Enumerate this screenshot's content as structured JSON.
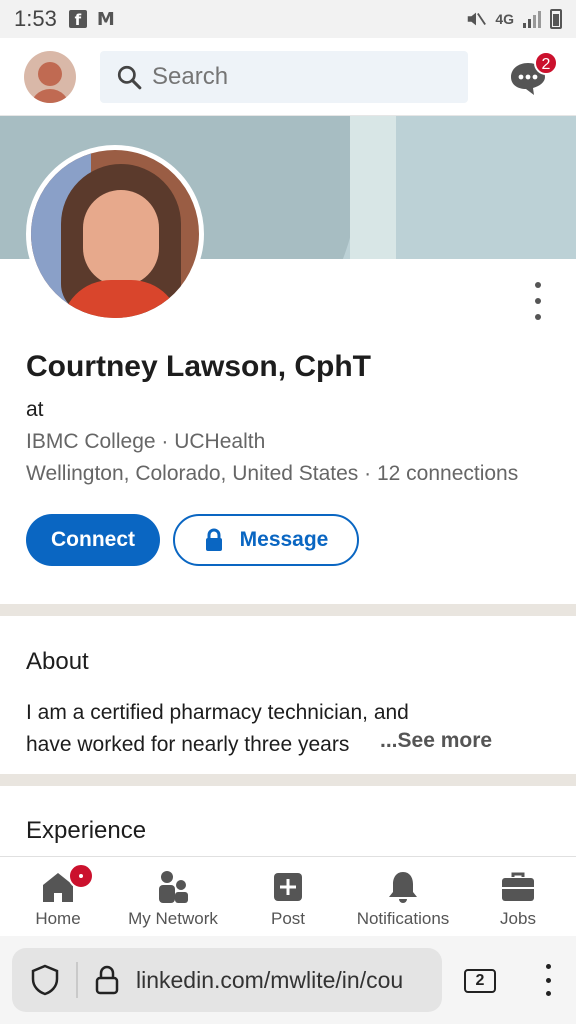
{
  "status_bar": {
    "time": "1:53",
    "network": "4G"
  },
  "top_nav": {
    "search_placeholder": "Search",
    "messages_badge": "2"
  },
  "profile": {
    "name": "Courtney Lawson, CphT",
    "headline": "at",
    "education": "IBMC College · UCHealth",
    "location": "Wellington, Colorado, United States · 12 connections",
    "connect_label": "Connect",
    "message_label": "Message"
  },
  "about": {
    "title": "About",
    "line1": "I am a certified pharmacy technician, and",
    "line2": "have worked for nearly three years",
    "see_more": "...See more"
  },
  "experience": {
    "title": "Experience"
  },
  "bottom_nav": {
    "items": [
      {
        "label": "Home",
        "icon": "home-icon"
      },
      {
        "label": "My Network",
        "icon": "network-icon"
      },
      {
        "label": "Post",
        "icon": "post-icon"
      },
      {
        "label": "Notifications",
        "icon": "bell-icon"
      },
      {
        "label": "Jobs",
        "icon": "briefcase-icon"
      }
    ]
  },
  "browser": {
    "url": "linkedin.com/mwlite/in/cou",
    "tab_count": "2"
  },
  "colors": {
    "brand_blue": "#0a66c2",
    "badge_red": "#cb112d",
    "divider": "#e9e5df"
  }
}
